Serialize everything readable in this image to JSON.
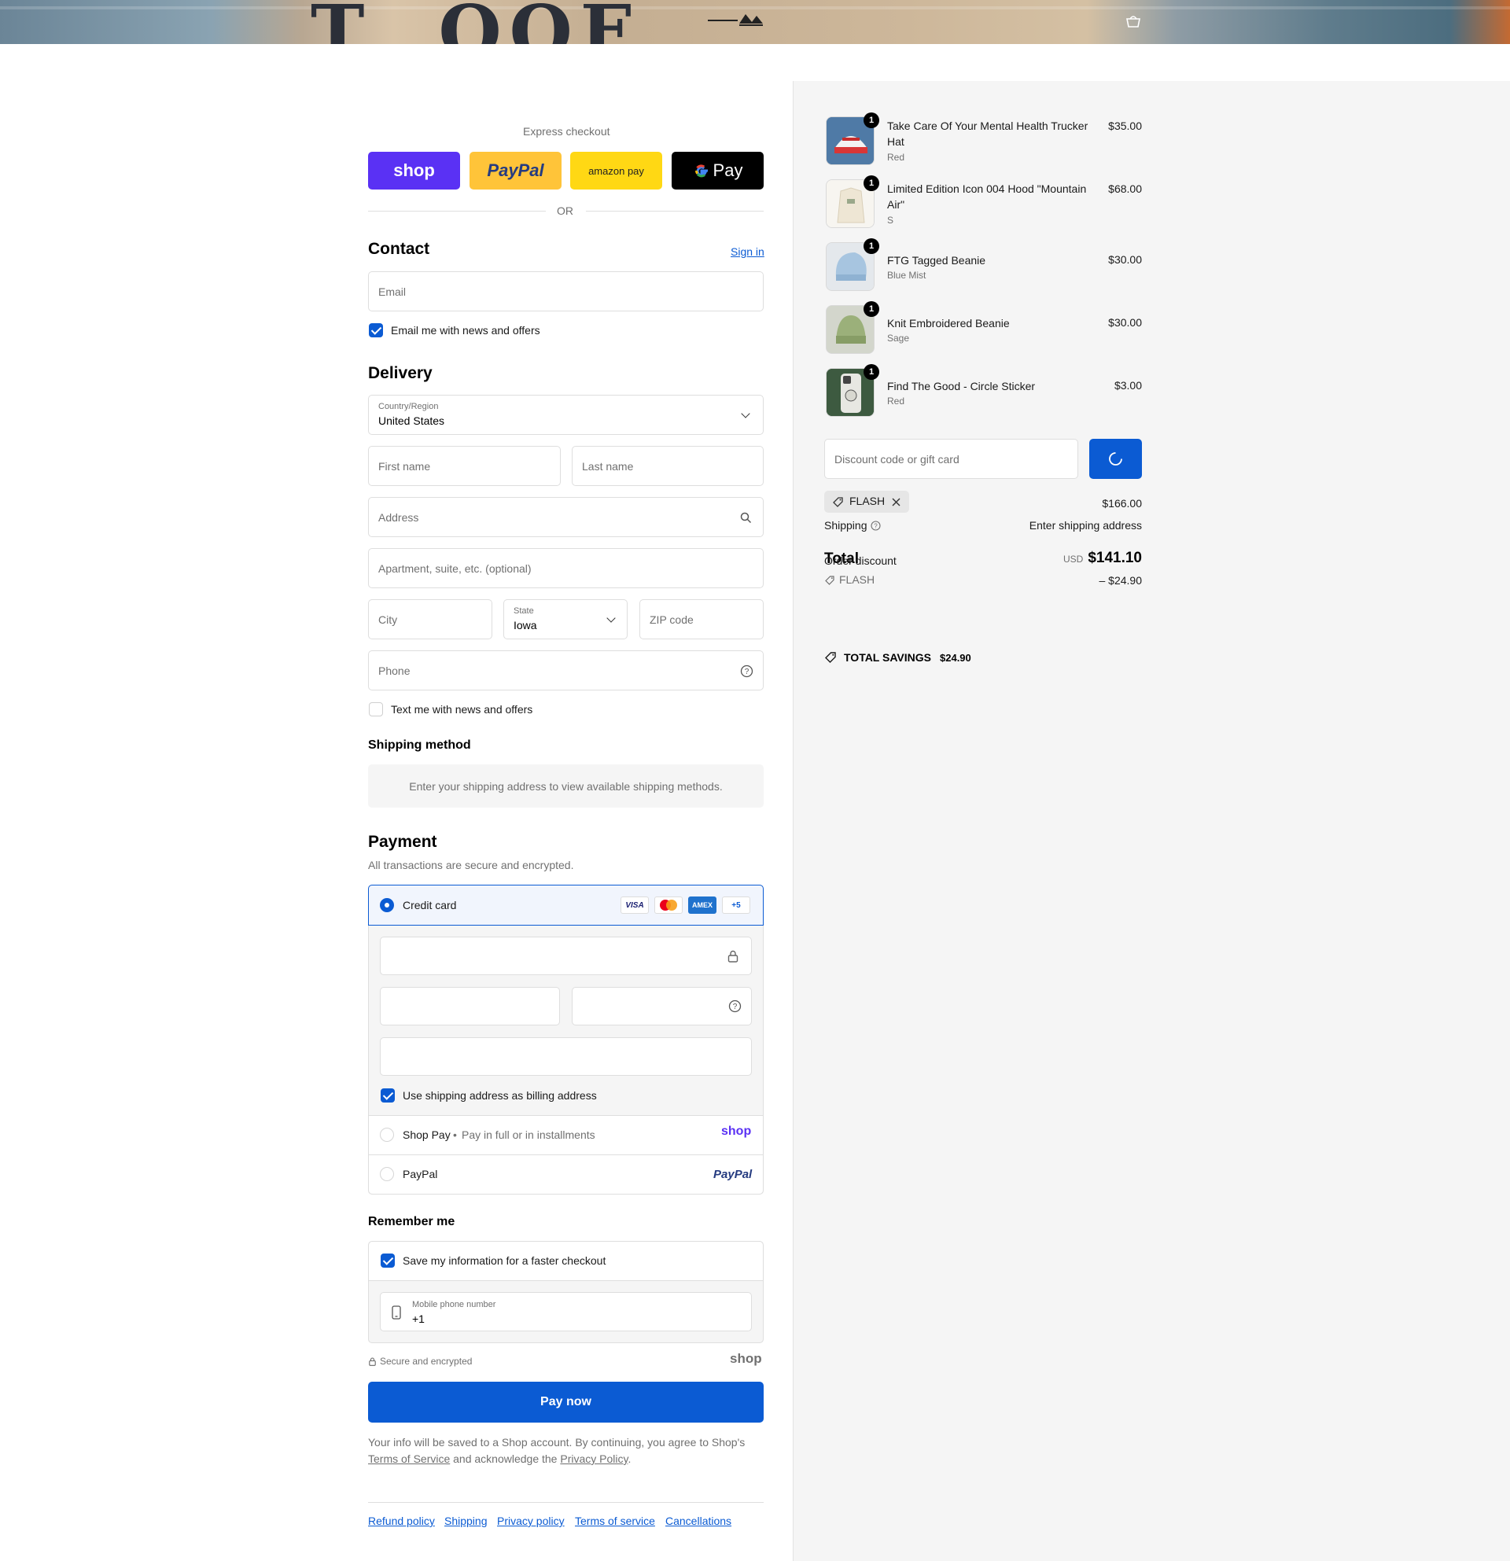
{
  "colors": {
    "accent": "#0b5bd3",
    "shop_purple": "#5a31f4",
    "paypal_yellow": "#ffc439",
    "amazon_yellow": "#ffd814",
    "summary_bg": "#f5f5f5"
  },
  "express": {
    "title": "Express checkout",
    "shop_label": "shop",
    "paypal_label": "PayPal",
    "amazon_label": "amazon pay",
    "gpay_label": "Pay",
    "or_label": "OR"
  },
  "contact": {
    "title": "Contact",
    "sign_in": "Sign in",
    "email_placeholder": "Email",
    "email_opt_in": "Email me with news and offers"
  },
  "delivery": {
    "title": "Delivery",
    "country_label": "Country/Region",
    "country_value": "United States",
    "first_name": "First name",
    "last_name": "Last name",
    "address": "Address",
    "apartment": "Apartment, suite, etc. (optional)",
    "city": "City",
    "state_label": "State",
    "state_value": "Iowa",
    "zip": "ZIP code",
    "phone": "Phone",
    "text_opt_in": "Text me with news and offers"
  },
  "shipping_method": {
    "title": "Shipping method",
    "notice": "Enter your shipping address to view available shipping methods."
  },
  "payment": {
    "title": "Payment",
    "subtitle": "All transactions are secure and encrypted.",
    "credit_card": "Credit card",
    "card_icons": [
      "VISA",
      "mastercard",
      "AMEX",
      "+5"
    ],
    "billing_same": "Use shipping address as billing address",
    "shop_pay": "Shop Pay",
    "shop_pay_sep": "•",
    "shop_pay_sub": "Pay in full or in installments",
    "shop_pay_logo": "shop",
    "paypal": "PayPal",
    "paypal_logo": "PayPal"
  },
  "remember": {
    "title": "Remember me",
    "save_info": "Save my information for a faster checkout",
    "mobile_label": "Mobile phone number",
    "mobile_value": "+1",
    "secure": "Secure and encrypted",
    "shop_logo": "shop"
  },
  "pay_now": "Pay now",
  "legal": {
    "line1": "Your info will be saved to a Shop account. By continuing, you agree to Shop's",
    "tos": "Terms of Service",
    "mid": "and acknowledge the",
    "privacy": "Privacy Policy",
    "end": "."
  },
  "footer_links": [
    "Refund policy",
    "Shipping",
    "Privacy policy",
    "Terms of service",
    "Cancellations"
  ],
  "cart": {
    "items": [
      {
        "name": "Take Care Of Your Mental Health Trucker Hat",
        "variant": "Red",
        "price": "$35.00",
        "qty": "1"
      },
      {
        "name": "Limited Edition Icon 004 Hood \"Mountain Air\"",
        "variant": "S",
        "price": "$68.00",
        "qty": "1"
      },
      {
        "name": "FTG Tagged Beanie",
        "variant": "Blue Mist",
        "price": "$30.00",
        "qty": "1"
      },
      {
        "name": "Knit Embroidered Beanie",
        "variant": "Sage",
        "price": "$30.00",
        "qty": "1"
      },
      {
        "name": "Find The Good - Circle Sticker",
        "variant": "Red",
        "price": "$3.00",
        "qty": "1"
      }
    ],
    "discount_placeholder": "Discount code or gift card",
    "applied_code": "FLASH",
    "subtotal": "$166.00",
    "shipping_label": "Shipping",
    "shipping_value": "Enter shipping address",
    "total_label": "Total",
    "currency": "USD",
    "total": "$141.10",
    "order_discount_label": "Order discount",
    "discount_code": "FLASH",
    "discount_amount": "– $24.90",
    "savings_label": "TOTAL SAVINGS",
    "savings_value": "$24.90"
  }
}
